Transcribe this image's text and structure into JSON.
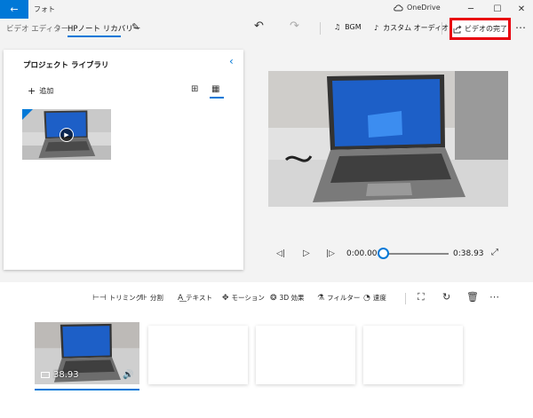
{
  "titlebar": {
    "app_title": "フォト",
    "onedrive_label": "OneDrive"
  },
  "toolbar": {
    "breadcrumb_root": "ビデオ エディター",
    "breadcrumb_separator": "〉",
    "project_name": "HPノート リカバリー",
    "bgm_label": "BGM",
    "custom_audio_label": "カスタム オーディオ",
    "finish_video_label": "ビデオの完了",
    "highlight_color": "#e8000b"
  },
  "library": {
    "title": "プロジェクト ライブラリ",
    "add_label": "追加"
  },
  "playback": {
    "current_time": "0:00.00",
    "total_time": "0:38.93",
    "progress": 0
  },
  "storyboard": {
    "tools": {
      "trim": "トリミング",
      "split": "分割",
      "text": "テキスト",
      "motion": "モーション",
      "effects_3d": "3D 効果",
      "filter": "フィルター",
      "speed": "速度"
    },
    "clips": [
      {
        "duration": "38.93"
      }
    ]
  },
  "colors": {
    "accent": "#0078d7"
  }
}
